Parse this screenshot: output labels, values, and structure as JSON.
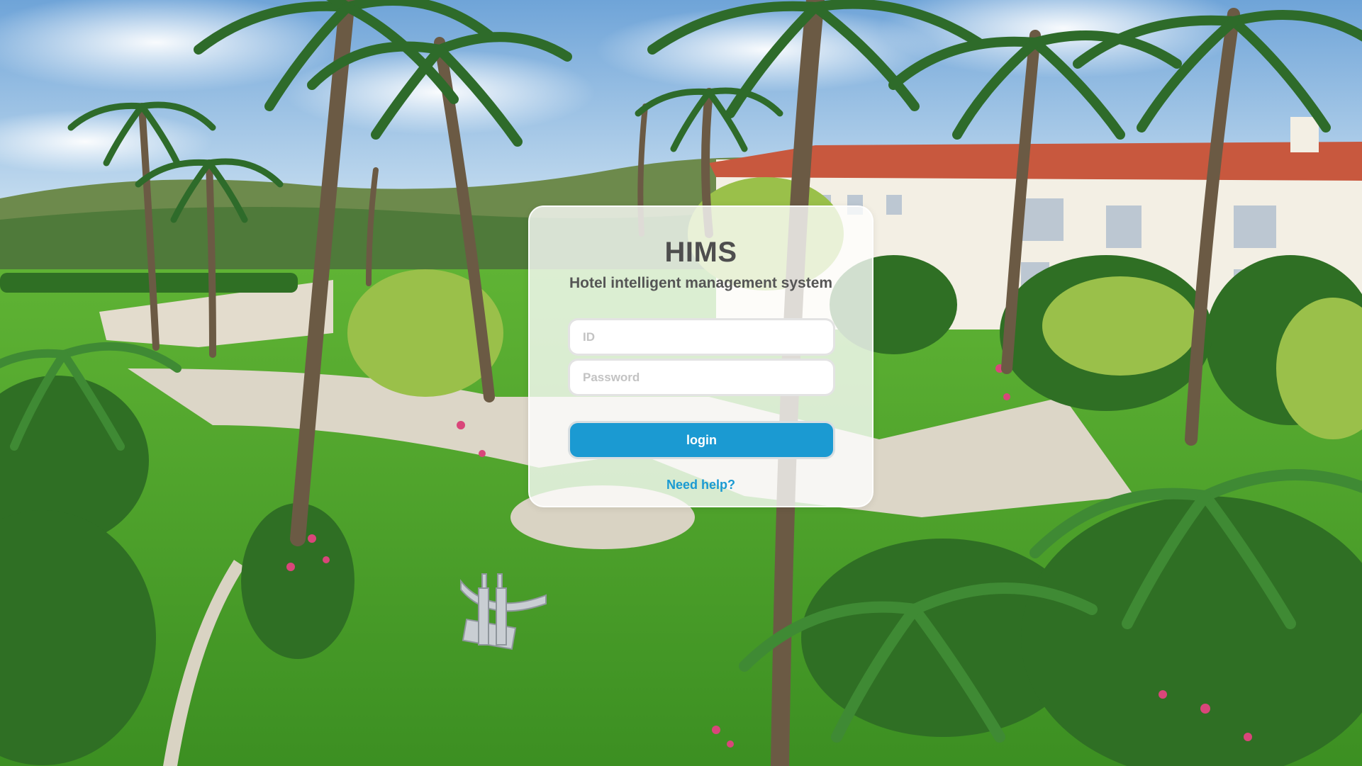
{
  "app": {
    "title": "HIMS",
    "subtitle": "Hotel intelligent management system"
  },
  "form": {
    "id_placeholder": "ID",
    "id_value": "",
    "password_placeholder": "Password",
    "password_value": "",
    "login_label": "login",
    "help_label": "Need help?"
  },
  "background": {
    "description_icon": "hotel-garden-photo",
    "sky_color": "#8fbde6",
    "lawn_color": "#4aa52a",
    "building_color": "#f3efe4",
    "roof_color": "#c8583e"
  },
  "colors": {
    "accent": "#1b9ad2",
    "title_text": "#4e4e4e",
    "card_background": "rgba(255,255,255,0.78)"
  }
}
